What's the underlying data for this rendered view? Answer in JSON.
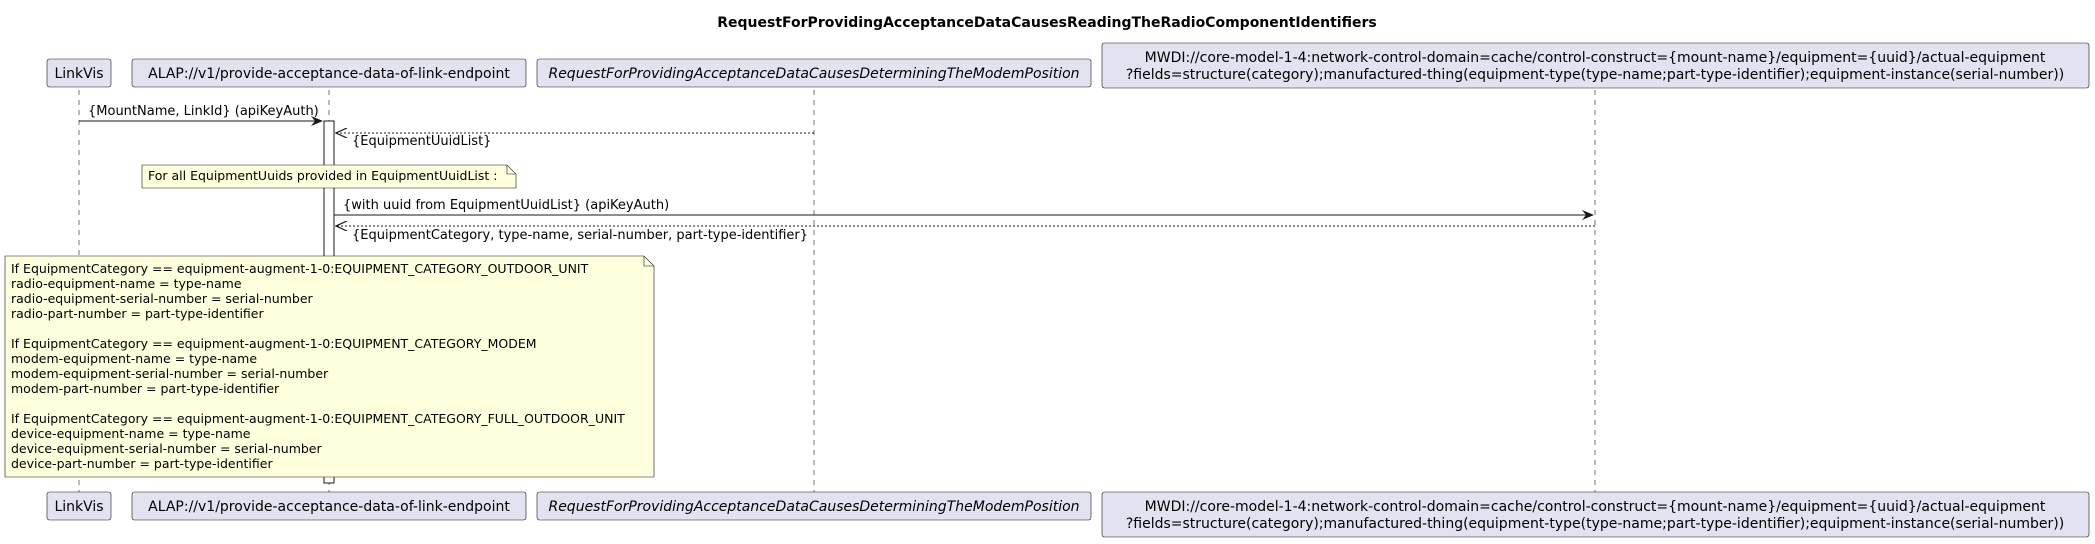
{
  "title": "RequestForProvidingAcceptanceDataCausesReadingTheRadioComponentIdentifiers",
  "participants": {
    "p1": {
      "label": "LinkVis"
    },
    "p2": {
      "label": "ALAP://v1/provide-acceptance-data-of-link-endpoint"
    },
    "p3": {
      "label": "RequestForProvidingAcceptanceDataCausesDeterminingTheModemPosition"
    },
    "p4": {
      "line1": "MWDI://core-model-1-4:network-control-domain=cache/control-construct={mount-name}/equipment={uuid}/actual-equipment",
      "line2": "?fields=structure(category);manufactured-thing(equipment-type(type-name;part-type-identifier);equipment-instance(serial-number))"
    }
  },
  "messages": {
    "m1": "{MountName, LinkId} (apiKeyAuth)",
    "m2": "{EquipmentUuidList}",
    "m3": "{with uuid from EquipmentUuidList} (apiKeyAuth)",
    "m4": "{EquipmentCategory, type-name, serial-number, part-type-identifier}"
  },
  "notes": {
    "loop": "For all EquipmentUuids provided in EquipmentUuidList :",
    "mapping": [
      "If EquipmentCategory == equipment-augment-1-0:EQUIPMENT_CATEGORY_OUTDOOR_UNIT",
      "radio-equipment-name = type-name",
      "radio-equipment-serial-number = serial-number",
      "radio-part-number = part-type-identifier",
      "",
      "If EquipmentCategory == equipment-augment-1-0:EQUIPMENT_CATEGORY_MODEM",
      "modem-equipment-name = type-name",
      "modem-equipment-serial-number = serial-number",
      "modem-part-number = part-type-identifier",
      "",
      "If EquipmentCategory == equipment-augment-1-0:EQUIPMENT_CATEGORY_FULL_OUTDOOR_UNIT",
      "device-equipment-name = type-name",
      "device-equipment-serial-number = serial-number",
      "device-part-number = part-type-identifier"
    ]
  },
  "colors": {
    "participant_fill": "#E2E2F0",
    "participant_border": "#181818",
    "note_fill": "#FEFFDD",
    "lifeline": "#181818"
  }
}
